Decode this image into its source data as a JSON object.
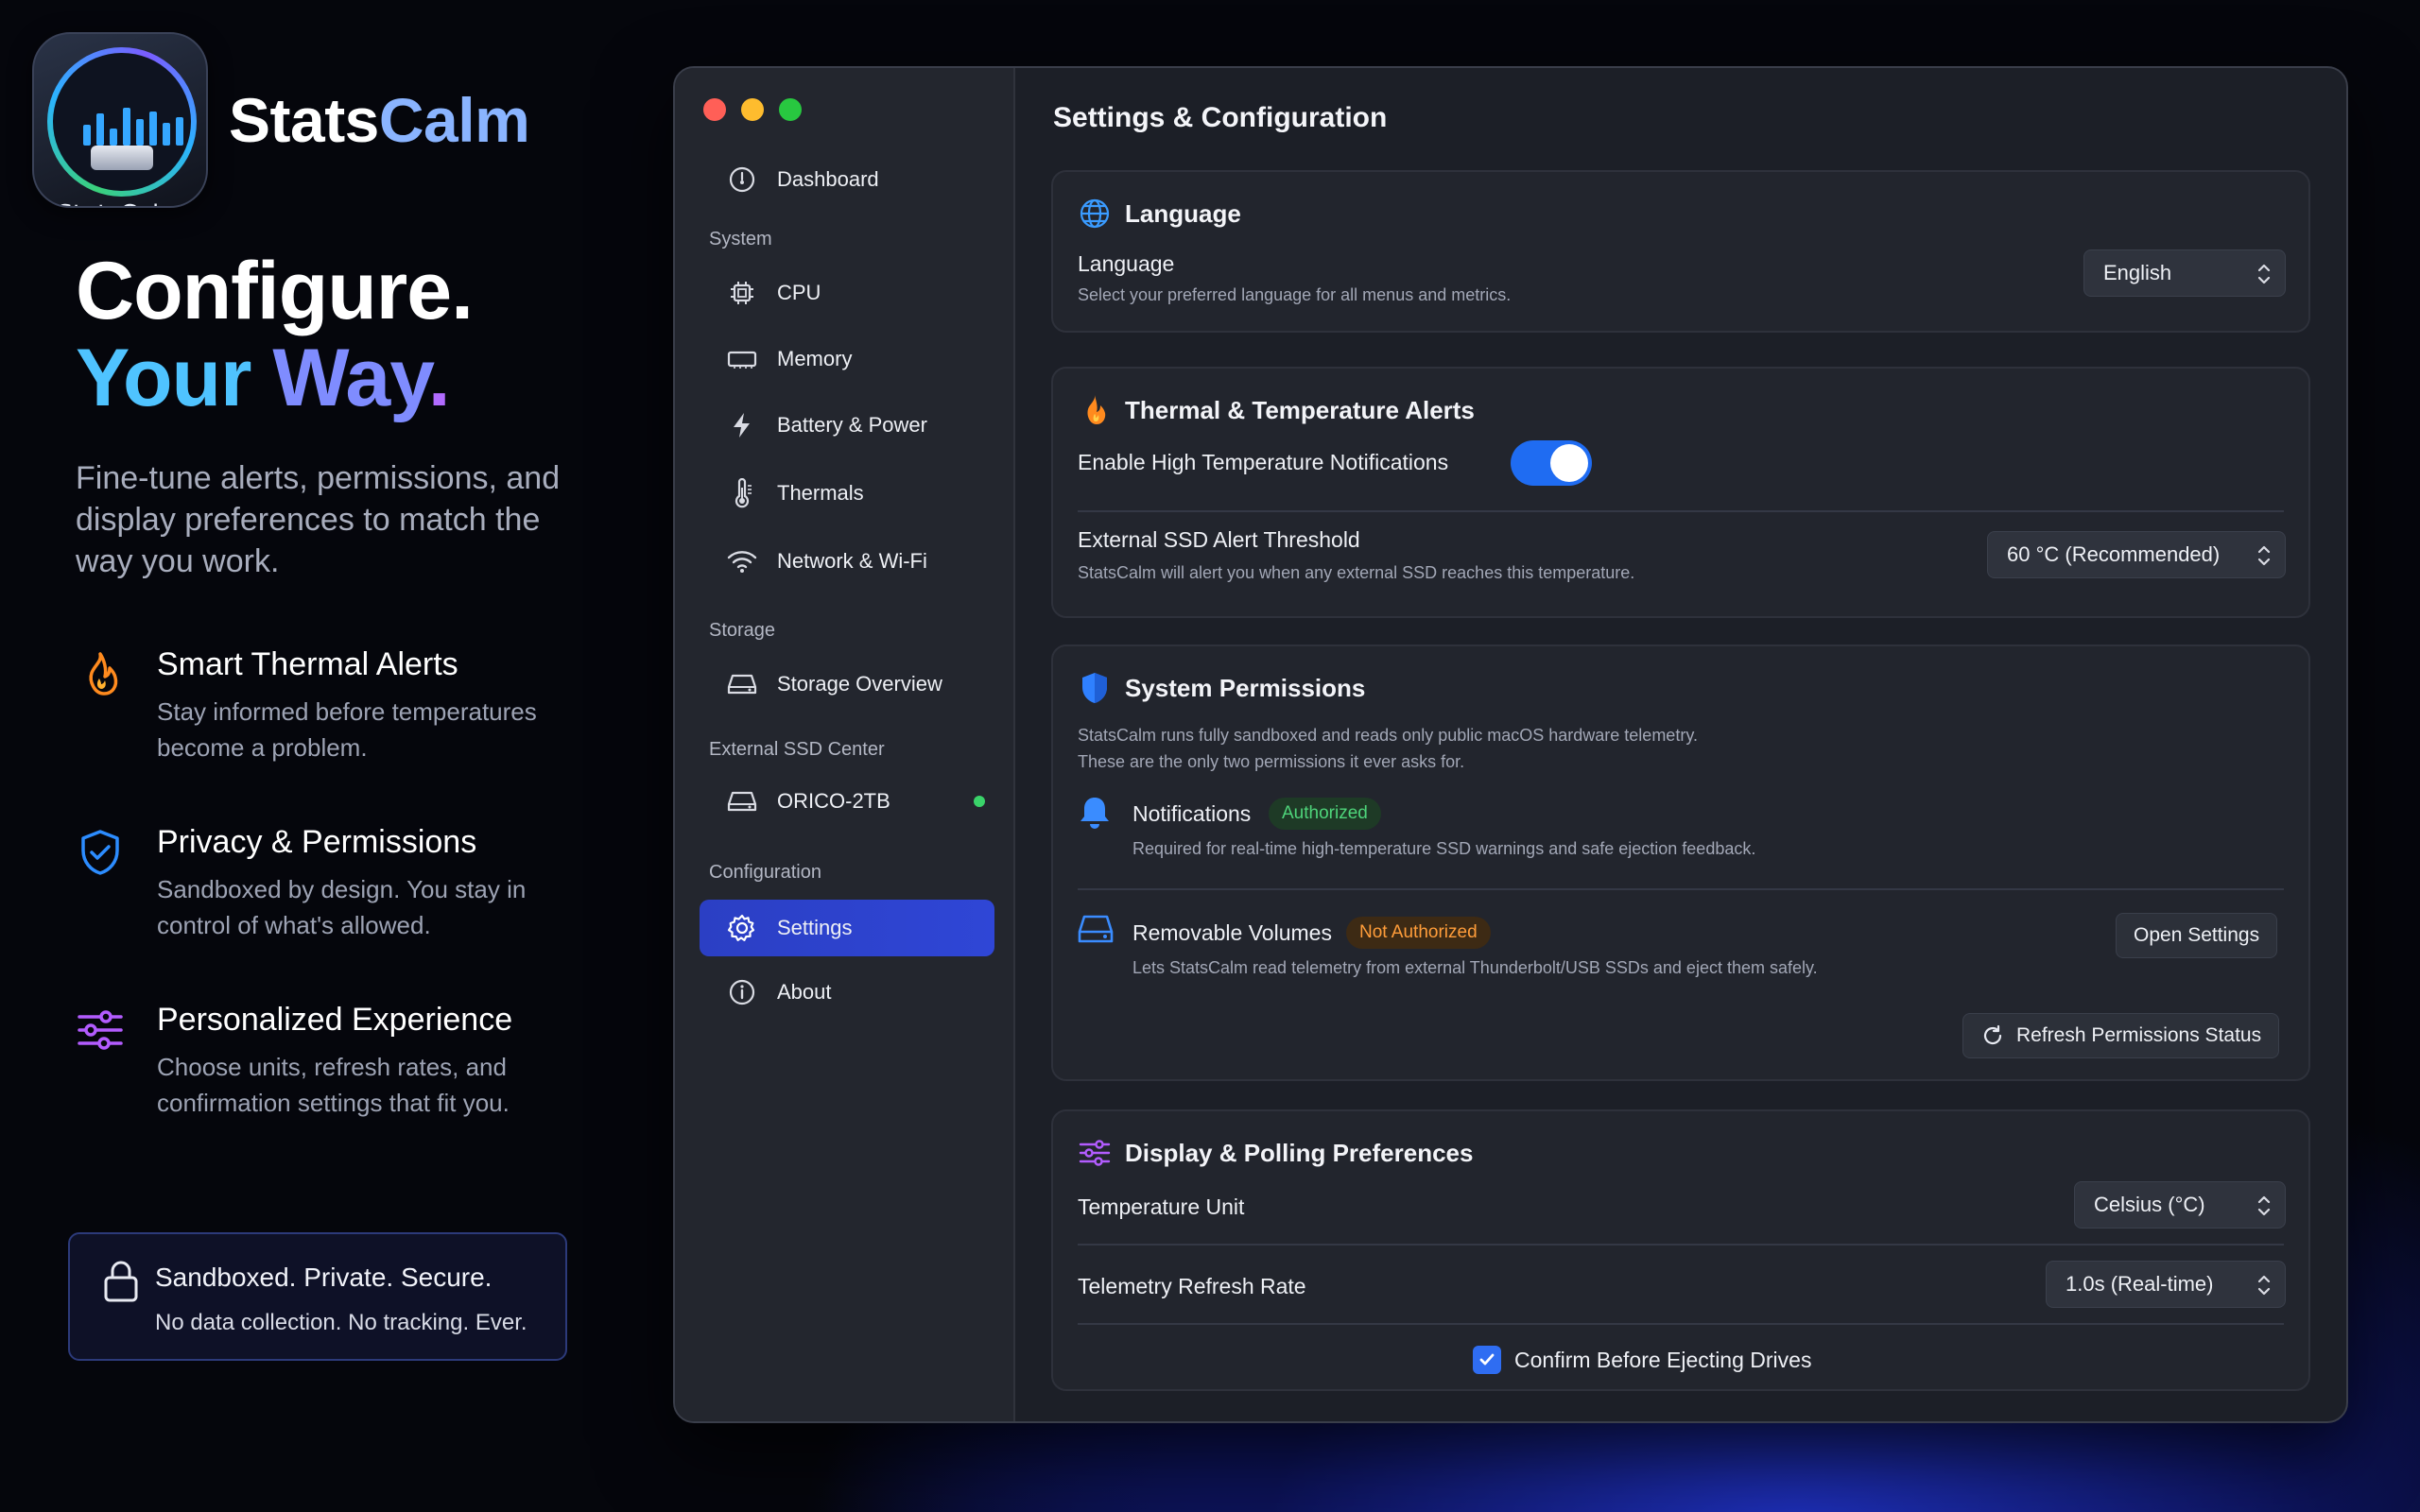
{
  "brand": {
    "icon_label": "StatsCalm",
    "name_part1": "Stats",
    "name_part2": "Calm"
  },
  "headline": {
    "line1": "Configure.",
    "line2_word1": "Your",
    "line2_word2": "Way",
    "line2_punct": "."
  },
  "subcopy": "Fine-tune alerts, permissions, and display preferences to match the way you work.",
  "features": [
    {
      "icon": "flame-icon",
      "title": "Smart Thermal Alerts",
      "desc": "Stay informed before temperatures become a problem."
    },
    {
      "icon": "shield-check-icon",
      "title": "Privacy & Permissions",
      "desc": "Sandboxed by design. You stay in control of what's allowed."
    },
    {
      "icon": "sliders-icon",
      "title": "Personalized Experience",
      "desc": "Choose units, refresh rates, and confirmation settings that fit you."
    }
  ],
  "secure": {
    "line1": "Sandboxed. Private. Secure.",
    "line2": "No data collection. No tracking. Ever."
  },
  "sidebar": {
    "dashboard": "Dashboard",
    "section_system": "System",
    "cpu": "CPU",
    "memory": "Memory",
    "battery": "Battery & Power",
    "thermals": "Thermals",
    "network": "Network & Wi-Fi",
    "section_storage": "Storage",
    "storage_overview": "Storage Overview",
    "section_external": "External SSD Center",
    "ssd_name": "ORICO-2TB",
    "section_config": "Configuration",
    "settings": "Settings",
    "about": "About"
  },
  "page": {
    "title": "Settings & Configuration"
  },
  "language_card": {
    "title": "Language",
    "label": "Language",
    "sub": "Select your preferred language for all menus and metrics.",
    "value": "English"
  },
  "thermal_card": {
    "title": "Thermal & Temperature Alerts",
    "toggle_label": "Enable High Temperature Notifications",
    "toggle_on": true,
    "threshold_label": "External SSD Alert Threshold",
    "threshold_sub": "StatsCalm will alert you when any external SSD reaches this temperature.",
    "threshold_value": "60 °C (Recommended)"
  },
  "permissions_card": {
    "title": "System Permissions",
    "intro1": "StatsCalm runs fully sandboxed and reads only public macOS hardware telemetry.",
    "intro2": "These are the only two permissions it ever asks for.",
    "notif_label": "Notifications",
    "notif_badge": "Authorized",
    "notif_sub": "Required for real-time high-temperature SSD warnings and safe ejection feedback.",
    "volumes_label": "Removable Volumes",
    "volumes_badge": "Not Authorized",
    "volumes_sub": "Lets StatsCalm read telemetry from external Thunderbolt/USB SSDs and eject them safely.",
    "open_settings": "Open Settings",
    "refresh": "Refresh Permissions Status"
  },
  "display_card": {
    "title": "Display & Polling Preferences",
    "unit_label": "Temperature Unit",
    "unit_value": "Celsius (°C)",
    "rate_label": "Telemetry Refresh Rate",
    "rate_value": "1.0s (Real-time)",
    "confirm_label": "Confirm Before Ejecting Drives",
    "confirm_checked": true
  },
  "colors": {
    "accent": "#2f46d6",
    "toggle": "#1f6cf2",
    "authorized": "#4ed47a",
    "not_authorized": "#ff9d3a",
    "online_dot": "#3ad36a"
  }
}
